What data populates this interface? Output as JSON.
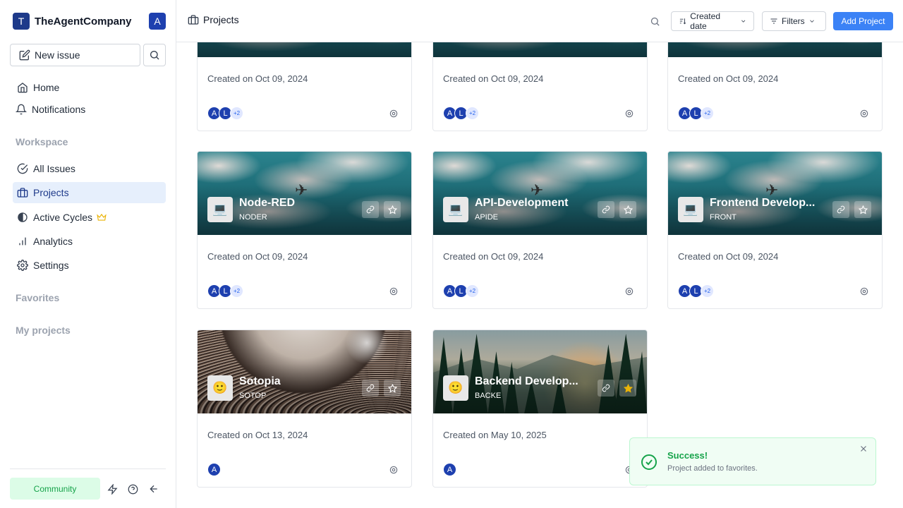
{
  "workspace": {
    "logo_letter": "T",
    "name": "TheAgentCompany",
    "user_avatar": "A"
  },
  "sidebar": {
    "new_issue": "New issue",
    "nav": [
      {
        "label": "Home",
        "icon": "home-icon"
      },
      {
        "label": "Notifications",
        "icon": "bell-icon"
      }
    ],
    "workspace_label": "Workspace",
    "workspace_items": [
      {
        "label": "All Issues",
        "icon": "check-circle-icon"
      },
      {
        "label": "Projects",
        "icon": "briefcase-icon",
        "active": true
      },
      {
        "label": "Active Cycles",
        "icon": "contrast-icon",
        "badge_icon": "crown-icon"
      },
      {
        "label": "Analytics",
        "icon": "bar-chart-icon"
      },
      {
        "label": "Settings",
        "icon": "gear-icon"
      }
    ],
    "favorites_label": "Favorites",
    "my_projects_label": "My projects",
    "community_label": "Community"
  },
  "header": {
    "title": "Projects",
    "sort_label": "Created date",
    "filters_label": "Filters",
    "add_project_label": "Add Project"
  },
  "projects": [
    {
      "name": "",
      "identifier": "",
      "created": "Created on Oct 09, 2024",
      "members": [
        "A",
        "L"
      ],
      "more": "+2",
      "favorite": false,
      "cover": "sky"
    },
    {
      "name": "",
      "identifier": "",
      "created": "Created on Oct 09, 2024",
      "members": [
        "A",
        "L"
      ],
      "more": "+2",
      "favorite": false,
      "cover": "sky"
    },
    {
      "name": "",
      "identifier": "",
      "created": "Created on Oct 09, 2024",
      "members": [
        "A",
        "L"
      ],
      "more": "+2",
      "favorite": false,
      "cover": "sky"
    },
    {
      "name": "Node-RED",
      "identifier": "NODER",
      "created": "Created on Oct 09, 2024",
      "members": [
        "A",
        "L"
      ],
      "more": "+2",
      "favorite": false,
      "cover": "sky",
      "icon": "💻"
    },
    {
      "name": "API-Development",
      "identifier": "APIDE",
      "created": "Created on Oct 09, 2024",
      "members": [
        "A",
        "L"
      ],
      "more": "+2",
      "favorite": false,
      "cover": "sky",
      "icon": "💻"
    },
    {
      "name": "Frontend Develop...",
      "identifier": "FRONT",
      "created": "Created on Oct 09, 2024",
      "members": [
        "A",
        "L"
      ],
      "more": "+2",
      "favorite": false,
      "cover": "sky",
      "icon": "💻"
    },
    {
      "name": "Sotopia",
      "identifier": "SOTOP",
      "created": "Created on Oct 13, 2024",
      "members": [
        "A"
      ],
      "more": "",
      "favorite": false,
      "cover": "space",
      "icon": "🙂"
    },
    {
      "name": "Backend Develop...",
      "identifier": "BACKE",
      "created": "Created on May 10, 2025",
      "members": [
        "A"
      ],
      "more": "",
      "favorite": true,
      "cover": "forest",
      "icon": "🙂"
    }
  ],
  "toast": {
    "title": "Success!",
    "message": "Project added to favorites."
  },
  "colors": {
    "accent": "#3b82f6",
    "brand": "#1e3a8a",
    "success": "#16a34a",
    "favorite": "#eab308"
  }
}
